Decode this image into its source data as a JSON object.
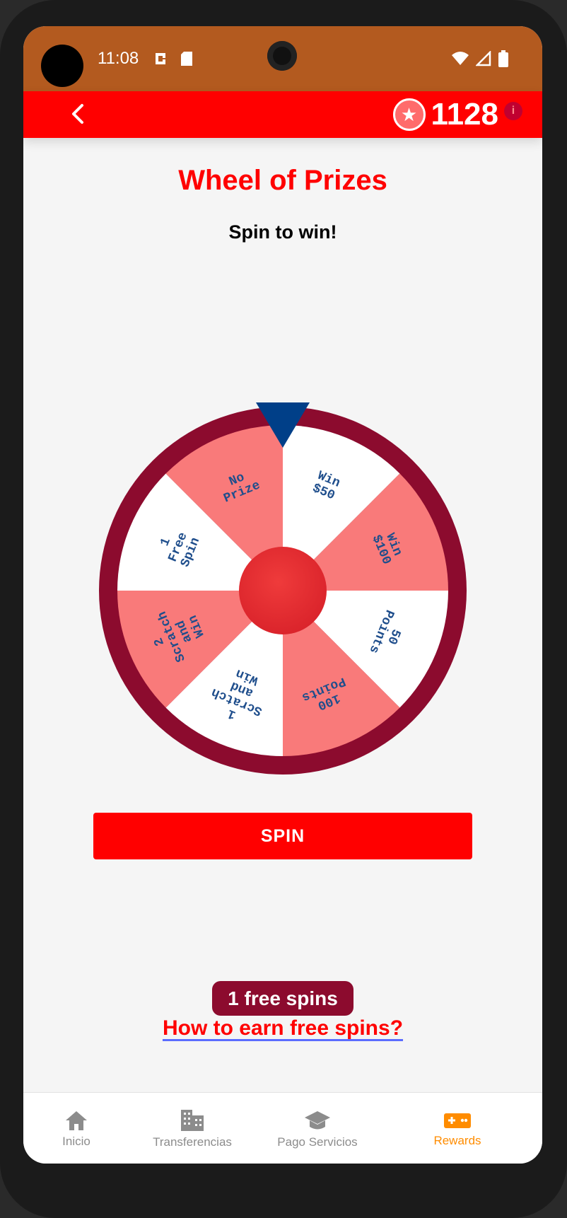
{
  "status": {
    "time": "11:08"
  },
  "header": {
    "points": "1128"
  },
  "page": {
    "title": "Wheel of Prizes",
    "subtitle": "Spin to win!"
  },
  "wheel": {
    "segments": [
      {
        "lines": [
          "Win",
          "$50"
        ],
        "color": "#ffffff"
      },
      {
        "lines": [
          "Win",
          "$100"
        ],
        "color": "#f97a7a"
      },
      {
        "lines": [
          "50",
          "Points"
        ],
        "color": "#ffffff"
      },
      {
        "lines": [
          "100",
          "Points"
        ],
        "color": "#f97a7a"
      },
      {
        "lines": [
          "1",
          "Scratch",
          "and",
          "Win"
        ],
        "color": "#ffffff"
      },
      {
        "lines": [
          "2",
          "Scratch",
          "and",
          "Win"
        ],
        "color": "#f97a7a"
      },
      {
        "lines": [
          "1",
          "Free",
          "Spin"
        ],
        "color": "#ffffff"
      },
      {
        "lines": [
          "No",
          "Prize"
        ],
        "color": "#f97a7a"
      }
    ],
    "rim_color": "#8c0b2e",
    "pointer_color": "#003f88",
    "text_color": "#1f4e8c",
    "hub_color": "#d9222a"
  },
  "actions": {
    "spin_label": "SPIN"
  },
  "free_spins": {
    "label": "1 free spins",
    "link": "How to earn free spins?"
  },
  "nav": {
    "items": [
      {
        "label": "Inicio",
        "icon": "home-icon"
      },
      {
        "label": "Transferencias",
        "icon": "building-icon"
      },
      {
        "label": "Pago Servicios",
        "icon": "graduation-cap-icon"
      },
      {
        "label": "Rewards",
        "icon": "gamepad-icon"
      }
    ]
  }
}
